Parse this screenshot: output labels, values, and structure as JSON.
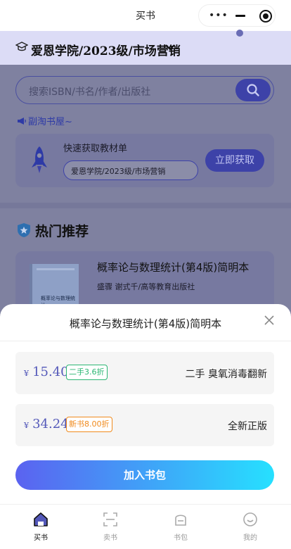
{
  "topbar": {
    "title": "买书"
  },
  "header": {
    "school": "爱恩学院/2023级/市场营销"
  },
  "search": {
    "placeholder": "搜索ISBN/书名/作者/出版社"
  },
  "promo": {
    "text": "副淘书屋~"
  },
  "quick_card": {
    "label": "快速获取教材单",
    "value": "爱恩学院/2023级/市场营销",
    "button": "立即获取"
  },
  "hot": {
    "title": "热门推荐",
    "book": {
      "title": "概率论与数理统计(第4版)简明本",
      "authors": "盛骤 谢式千/高等教育出版社",
      "cover_text": "概率论与数理统计"
    }
  },
  "sheet": {
    "title": "概率论与数理统计(第4版)简明本",
    "options": [
      {
        "currency": "¥",
        "price": "15.40",
        "tag": "二手3.6折",
        "desc": "二手 臭氧消毒翻新",
        "tag_color": "#2bb673"
      },
      {
        "currency": "¥",
        "price": "34.24",
        "tag": "新书8.00折",
        "desc": "全新正版",
        "tag_color": "#f08a1c"
      }
    ],
    "add_button": "加入书包"
  },
  "tabs": [
    {
      "label": "买书",
      "icon": "home-icon",
      "active": true
    },
    {
      "label": "卖书",
      "icon": "scan-icon",
      "active": false
    },
    {
      "label": "书包",
      "icon": "bag-icon",
      "active": false
    },
    {
      "label": "我的",
      "icon": "profile-icon",
      "active": false
    }
  ],
  "colors": {
    "accent": "#5358b9",
    "used_tag": "#2bb673",
    "new_tag": "#f08a1c"
  }
}
